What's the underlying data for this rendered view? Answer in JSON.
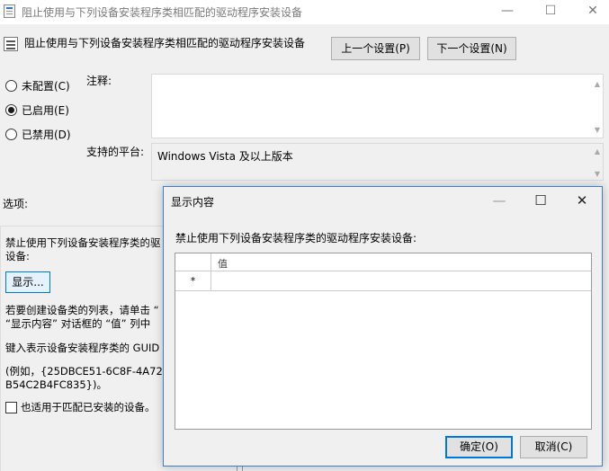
{
  "window": {
    "title": "阻止使用与下列设备安装程序类相匹配的驱动程序安装设备",
    "minimize": "—",
    "maximize": "☐",
    "close": "✕"
  },
  "header": {
    "title": "阻止使用与下列设备安装程序类相匹配的驱动程序安装设备",
    "prev_button": "上一个设置(P)",
    "next_button": "下一个设置(N)"
  },
  "state": {
    "not_configured": "未配置(C)",
    "enabled": "已启用(E)",
    "disabled": "已禁用(D)",
    "selected": "enabled"
  },
  "comment": {
    "label": "注释:",
    "value": ""
  },
  "platform": {
    "label": "支持的平台:",
    "value": "Windows Vista 及以上版本"
  },
  "options": {
    "label": "选项:",
    "line1": "禁止使用下列设备安装程序类的驱",
    "line2": "设备:",
    "show_button": "显示...",
    "help1": "若要创建设备类的列表，请单击 “",
    "help2": "“显示内容” 对话框的 “值” 列中",
    "help3": "键入表示设备安装程序类的 GUID",
    "help4": "(例如，{25DBCE51-6C8F-4A72-",
    "help5": "B54C2B4FC835})。",
    "also_apply": "也适用于匹配已安装的设备。"
  },
  "dialog": {
    "title": "显示内容",
    "minimize": "—",
    "maximize": "☐",
    "close": "✕",
    "label": "禁止使用下列设备安装程序类的驱动程序安装设备:",
    "column_value": "值",
    "new_row_marker": "*",
    "ok_button": "确定(O)",
    "cancel_button": "取消(C)"
  }
}
